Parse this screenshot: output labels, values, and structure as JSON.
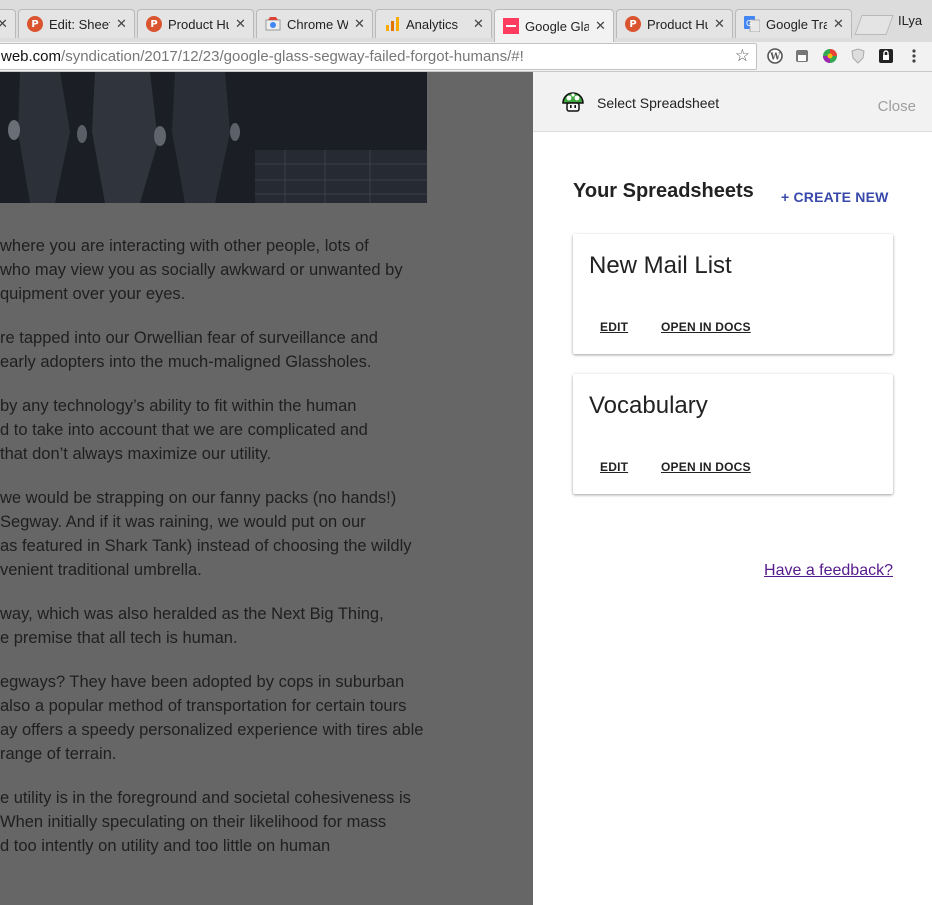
{
  "browser": {
    "tabs": [
      {
        "title": "ry ×",
        "icon": "tab-fragment",
        "active": false
      },
      {
        "title": "Edit: Sheet",
        "icon": "producthunt-icon",
        "active": false
      },
      {
        "title": "Product Hu",
        "icon": "producthunt-icon",
        "active": false
      },
      {
        "title": "Chrome We",
        "icon": "chrome-webstore-icon",
        "active": false
      },
      {
        "title": "Analytics",
        "icon": "analytics-icon",
        "active": false
      },
      {
        "title": "Google Glas",
        "icon": "tnw-icon",
        "active": true
      },
      {
        "title": "Product Hu",
        "icon": "producthunt-icon",
        "active": false
      },
      {
        "title": "Google Trar",
        "icon": "google-translate-icon",
        "active": false
      }
    ],
    "profile_name": "ILya",
    "url_domain": "web.com",
    "url_path": "/syndication/2017/12/23/google-glass-segway-failed-forgot-humans/#!",
    "extensions": [
      "wordpress-icon",
      "incognito-hat-icon",
      "colorful-ball-icon",
      "shield-icon",
      "lock-icon",
      "menu-dots-icon"
    ]
  },
  "article": {
    "paragraphs": [
      [
        "where you are interacting with other people, lots of",
        "who may view you as socially awkward or unwanted by",
        "quipment over your eyes."
      ],
      [
        "re tapped into our Orwellian fear of surveillance and",
        "early adopters into the much-maligned Glassholes."
      ],
      [
        "by any technology’s ability to fit within the human",
        "d to take into account that we are complicated and",
        "that don’t always maximize our utility."
      ],
      [
        "we would be strapping on our fanny packs (no hands!)",
        "Segway. And if it was raining, we would put on our",
        "as featured in Shark Tank) instead of choosing the wildly",
        "venient traditional umbrella."
      ],
      [
        "way, which was also heralded as the Next Big Thing,",
        "e premise that all tech is human."
      ],
      [
        "egways? They have been adopted by cops in suburban",
        "also a popular method of transportation for certain tours",
        "ay offers a speedy personalized experience with tires able",
        "range of terrain."
      ],
      [
        "e utility is in the foreground and societal cohesiveness is",
        "When initially speculating on their likelihood for mass",
        "d too intently on utility and too little on human"
      ]
    ]
  },
  "panel": {
    "header_title": "Select Spreadsheet",
    "close_label": "Close",
    "section_title": "Your Spreadsheets",
    "create_new_label": "+ CREATE NEW",
    "spreadsheets": [
      {
        "name": "New Mail List",
        "edit_label": "EDIT",
        "open_label": "OPEN IN DOCS"
      },
      {
        "name": "Vocabulary",
        "edit_label": "EDIT",
        "open_label": "OPEN IN DOCS"
      }
    ],
    "feedback_label": "Have a feedback?",
    "accent_color": "#3949ab",
    "link_color": "#551a8b"
  }
}
